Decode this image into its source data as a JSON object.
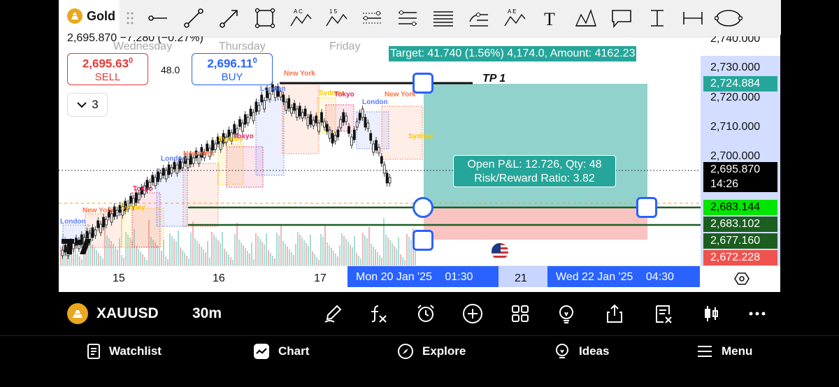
{
  "symbol": {
    "short_name": "Gold",
    "ticker": "XAUUSD",
    "interval": "30m",
    "price_change": "2,695.870 −7.280 (−0.27%)"
  },
  "days": {
    "wednesday": "Wednesday",
    "thursday": "Thursday",
    "friday": "Friday"
  },
  "trade": {
    "sell_price": "2,695.63",
    "sell_price_sup": "0",
    "sell_label": "SELL",
    "buy_price": "2,696.11",
    "buy_price_sup": "0",
    "buy_label": "BUY",
    "spread": "48.0"
  },
  "collapse": {
    "count": "3"
  },
  "position": {
    "target_text": "Target: 41.740 (1.56%) 4,174.0, Amount: 4162.23",
    "pnl_line1": "Open P&L: 12.726, Qty: 48",
    "pnl_line2": "Risk/Reward Ratio: 3.82",
    "tp_label": "TP 1"
  },
  "price_axis": {
    "labels": [
      "2,740.000",
      "2,730.000",
      "2,720.000",
      "2,710.000",
      "2,700.000"
    ],
    "tags": [
      {
        "text": "2,724.884",
        "bg": "#26a69a",
        "fg": "#ffffff"
      },
      {
        "text": "2,695.870",
        "bg": "#000000",
        "fg": "#ffffff"
      },
      {
        "text": "14:26",
        "bg": "#000000",
        "fg": "#ffffff"
      },
      {
        "text": "2,683.144",
        "bg": "#00e600",
        "fg": "#000000"
      },
      {
        "text": "2,683.102",
        "bg": "#1b5e20",
        "fg": "#ffffff"
      },
      {
        "text": "2,677.160",
        "bg": "#1b5e20",
        "fg": "#ffffff"
      },
      {
        "text": "2,672.228",
        "bg": "#ef5350",
        "fg": "#ffffff"
      }
    ]
  },
  "time_axis": {
    "ticks": [
      "15",
      "16",
      "17",
      "21"
    ],
    "start_chip": "Mon 20 Jan '25",
    "start_time": "01:30",
    "end_chip": "Wed 22 Jan '25",
    "end_time": "04:30"
  },
  "sessions": [
    "New York",
    "London",
    "Tokyo",
    "Sydney"
  ],
  "colors": {
    "accent": "#2962ff",
    "sell": "#e53935",
    "buy": "#2962ff",
    "profit": "#26a69a",
    "loss": "#ef5350",
    "candle": "#111111",
    "session_ny": "#ff7043",
    "session_london": "#5c7cff",
    "session_tokyo": "#e91e63",
    "session_sydney": "#f9c900"
  },
  "toolbar": {
    "icons": [
      "trend-line-icon",
      "ray-icon",
      "arrow-icon",
      "rectangle-icon",
      "abcd-pattern-icon",
      "elliott-wave-icon",
      "parallel-channel-icon",
      "regression-channel-icon",
      "fib-retracement-icon",
      "pitchfork-icon",
      "ae-pattern-icon",
      "text-icon",
      "xabcd-pattern-icon",
      "callout-icon",
      "price-range-icon",
      "date-range-icon",
      "ellipse-icon"
    ],
    "labels": {
      "ac": "A C",
      "fifteen": "1 5",
      "ae": "A E",
      "text": "T"
    }
  },
  "symbol_bar_icons": [
    "brush-icon",
    "function-icon",
    "alarm-icon",
    "plus-circle-icon",
    "grid-icon",
    "lightbulb-icon",
    "share-icon",
    "trading-panel-icon",
    "candles-icon",
    "more-icon"
  ],
  "nav": {
    "watchlist": "Watchlist",
    "chart": "Chart",
    "explore": "Explore",
    "ideas": "Ideas",
    "menu": "Menu"
  }
}
